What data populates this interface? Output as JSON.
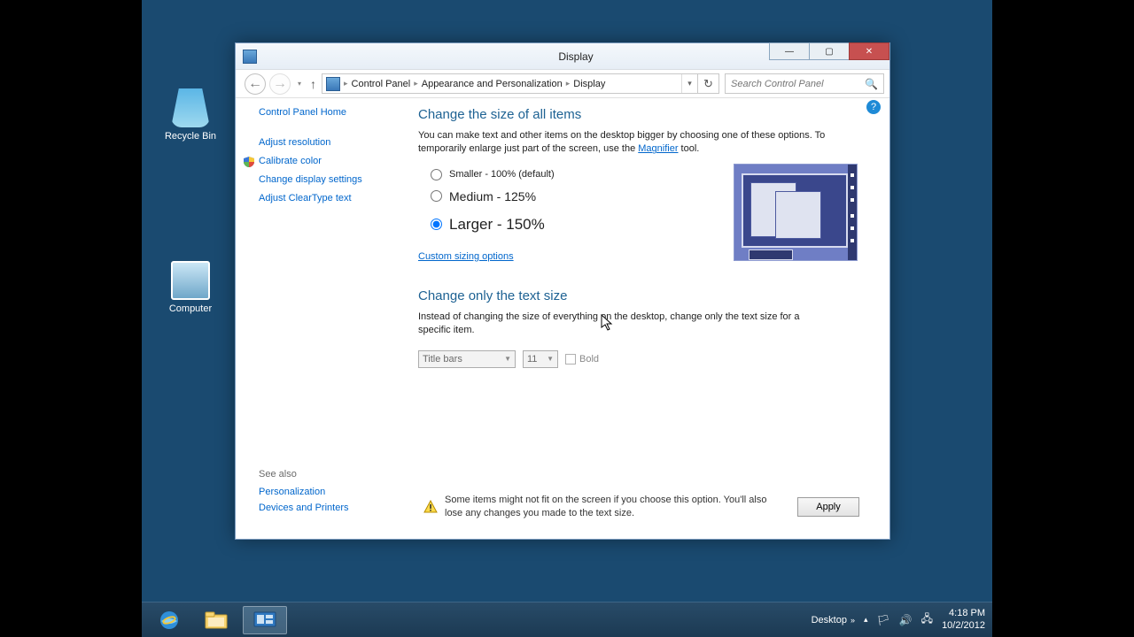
{
  "desktop": {
    "recycle_label": "Recycle Bin",
    "computer_label": "Computer"
  },
  "window": {
    "title": "Display",
    "breadcrumb": [
      "Control Panel",
      "Appearance and Personalization",
      "Display"
    ],
    "search_placeholder": "Search Control Panel"
  },
  "sidebar": {
    "home": "Control Panel Home",
    "tasks": [
      "Adjust resolution",
      "Calibrate color",
      "Change display settings",
      "Adjust ClearType text"
    ],
    "see_also_heading": "See also",
    "see_also": [
      "Personalization",
      "Devices and Printers"
    ]
  },
  "main": {
    "heading1": "Change the size of all items",
    "desc1_pre": "You can make text and other items on the desktop bigger by choosing one of these options. To temporarily enlarge just part of the screen, use the ",
    "desc1_link": "Magnifier",
    "desc1_post": " tool.",
    "radio_smaller": "Smaller - 100% (default)",
    "radio_medium": "Medium - 125%",
    "radio_larger": "Larger - 150%",
    "custom_link": "Custom sizing options",
    "heading2": "Change only the text size",
    "desc2": "Instead of changing the size of everything on the desktop, change only the text size for a specific item.",
    "dropdown_item": "Title bars",
    "dropdown_size": "11",
    "bold_label": "Bold",
    "warning_text": "Some items might not fit on the screen if you choose this option. You'll also lose any changes you made to the text size.",
    "apply_label": "Apply"
  },
  "taskbar": {
    "desktop_label": "Desktop",
    "time": "4:18 PM",
    "date": "10/2/2012"
  }
}
